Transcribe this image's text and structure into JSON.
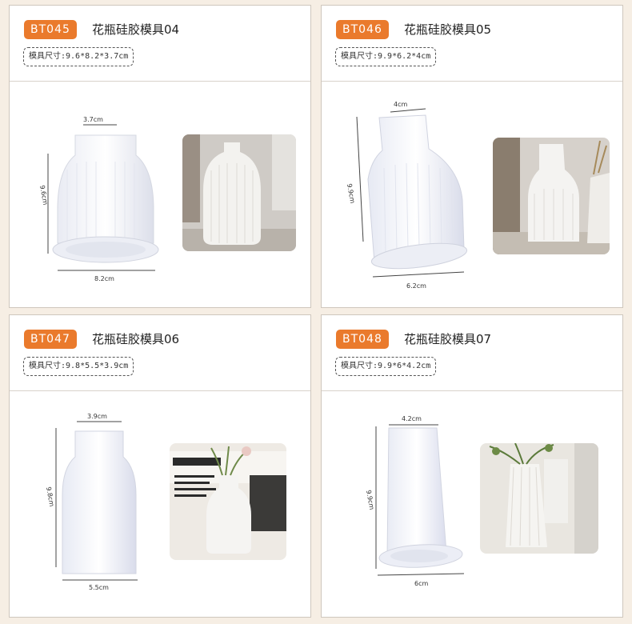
{
  "cards": [
    {
      "code": "BT045",
      "title": "花瓶硅胶模具04",
      "size_label": "模具尺寸:9.6*8.2*3.7cm",
      "dims": {
        "top": "3.7cm",
        "side": "9.6cm",
        "bottom": "8.2cm"
      }
    },
    {
      "code": "BT046",
      "title": "花瓶硅胶模具05",
      "size_label": "模具尺寸:9.9*6.2*4cm",
      "dims": {
        "top": "4cm",
        "side": "9.9cm",
        "bottom": "6.2cm"
      }
    },
    {
      "code": "BT047",
      "title": "花瓶硅胶模具06",
      "size_label": "模具尺寸:9.8*5.5*3.9cm",
      "dims": {
        "top": "3.9cm",
        "side": "9.8cm",
        "bottom": "5.5cm"
      }
    },
    {
      "code": "BT048",
      "title": "花瓶硅胶模具07",
      "size_label": "模具尺寸:9.9*6*4.2cm",
      "dims": {
        "top": "4.2cm",
        "side": "9.9cm",
        "bottom": "6cm"
      }
    }
  ]
}
